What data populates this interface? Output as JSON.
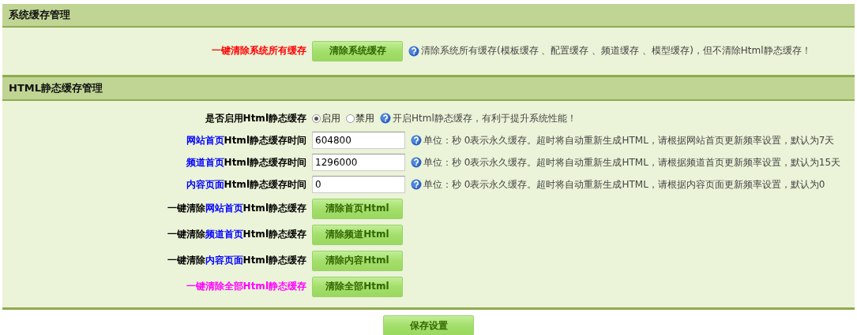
{
  "sections": [
    {
      "title": "系统缓存管理",
      "rows": [
        {
          "kind": "button",
          "label": [
            {
              "text": "一键清除系统所有缓存",
              "color": "#ff0000"
            }
          ],
          "button": "清除系统缓存",
          "help": "清除系统所有缓存(模板缓存 、配置缓存 、频道缓存 、模型缓存)，但不清除Html静态缓存！"
        }
      ]
    },
    {
      "title": "HTML静态缓存管理",
      "rows": [
        {
          "kind": "radio",
          "label": [
            {
              "text": "是否启用Html静态缓存",
              "color": "#000000"
            }
          ],
          "options": [
            {
              "label": "启用",
              "selected": true
            },
            {
              "label": "禁用",
              "selected": false
            }
          ],
          "help": "开启Html静态缓存，有利于提升系统性能！"
        },
        {
          "kind": "input",
          "label": [
            {
              "text": "网站首页",
              "color": "#0000ff"
            },
            {
              "text": "Html静态缓存时间",
              "color": "#000000"
            }
          ],
          "value": "604800",
          "help": "单位：秒 0表示永久缓存。超时将自动重新生成HTML，请根据网站首页更新频率设置，默认为7天"
        },
        {
          "kind": "input",
          "label": [
            {
              "text": "频道首页",
              "color": "#0000ff"
            },
            {
              "text": "Html静态缓存时间",
              "color": "#000000"
            }
          ],
          "value": "1296000",
          "help": "单位：秒 0表示永久缓存。超时将自动重新生成HTML，请根据频道首页更新频率设置，默认为15天"
        },
        {
          "kind": "input",
          "label": [
            {
              "text": "内容页面",
              "color": "#0000ff"
            },
            {
              "text": "Html静态缓存时间",
              "color": "#000000"
            }
          ],
          "value": "0",
          "help": "单位：秒 0表示永久缓存。超时将自动重新生成HTML，请根据内容页面更新频率设置，默认为0"
        },
        {
          "kind": "button",
          "label": [
            {
              "text": "一键清除",
              "color": "#000000"
            },
            {
              "text": "网站首页",
              "color": "#0000ff"
            },
            {
              "text": "Html静态缓存",
              "color": "#000000"
            }
          ],
          "button": "清除首页Html"
        },
        {
          "kind": "button",
          "label": [
            {
              "text": "一键清除",
              "color": "#000000"
            },
            {
              "text": "频道首页",
              "color": "#0000ff"
            },
            {
              "text": "Html静态缓存",
              "color": "#000000"
            }
          ],
          "button": "清除频道Html"
        },
        {
          "kind": "button",
          "label": [
            {
              "text": "一键清除",
              "color": "#000000"
            },
            {
              "text": "内容页面",
              "color": "#0000ff"
            },
            {
              "text": "Html静态缓存",
              "color": "#000000"
            }
          ],
          "button": "清除内容Html"
        },
        {
          "kind": "button",
          "label": [
            {
              "text": "一键清除全部Html静态缓存",
              "color": "#ff00ff"
            }
          ],
          "button": "清除全部Html"
        }
      ]
    }
  ],
  "save_button": "保存设置"
}
